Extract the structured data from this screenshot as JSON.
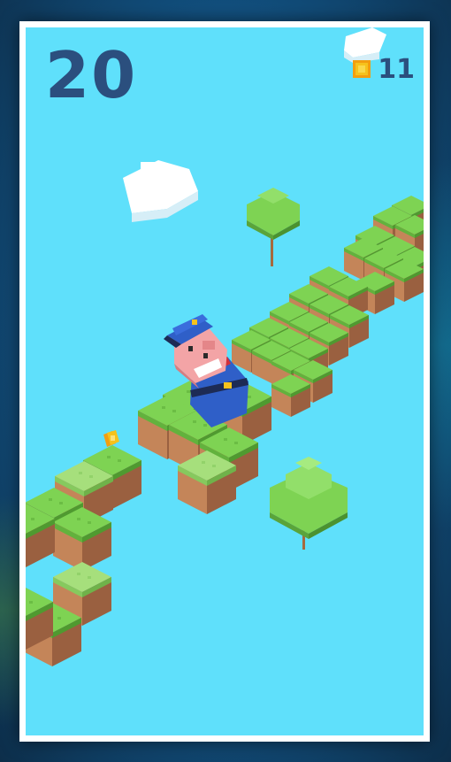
{
  "hud": {
    "score": "20",
    "coin_count": "11"
  },
  "colors": {
    "sky": "#5fe0fb",
    "grass_top": "#7ed353",
    "grass_light_top": "#a6df7c",
    "dirt_side": "#b97a53",
    "score_text": "#2b4f7e",
    "coin": "#f6c21c"
  },
  "scene": {
    "character": "pig-police-officer",
    "pickups": [
      "gold-coin"
    ],
    "decor": [
      "cloud",
      "cloud",
      "tree",
      "tree"
    ]
  }
}
